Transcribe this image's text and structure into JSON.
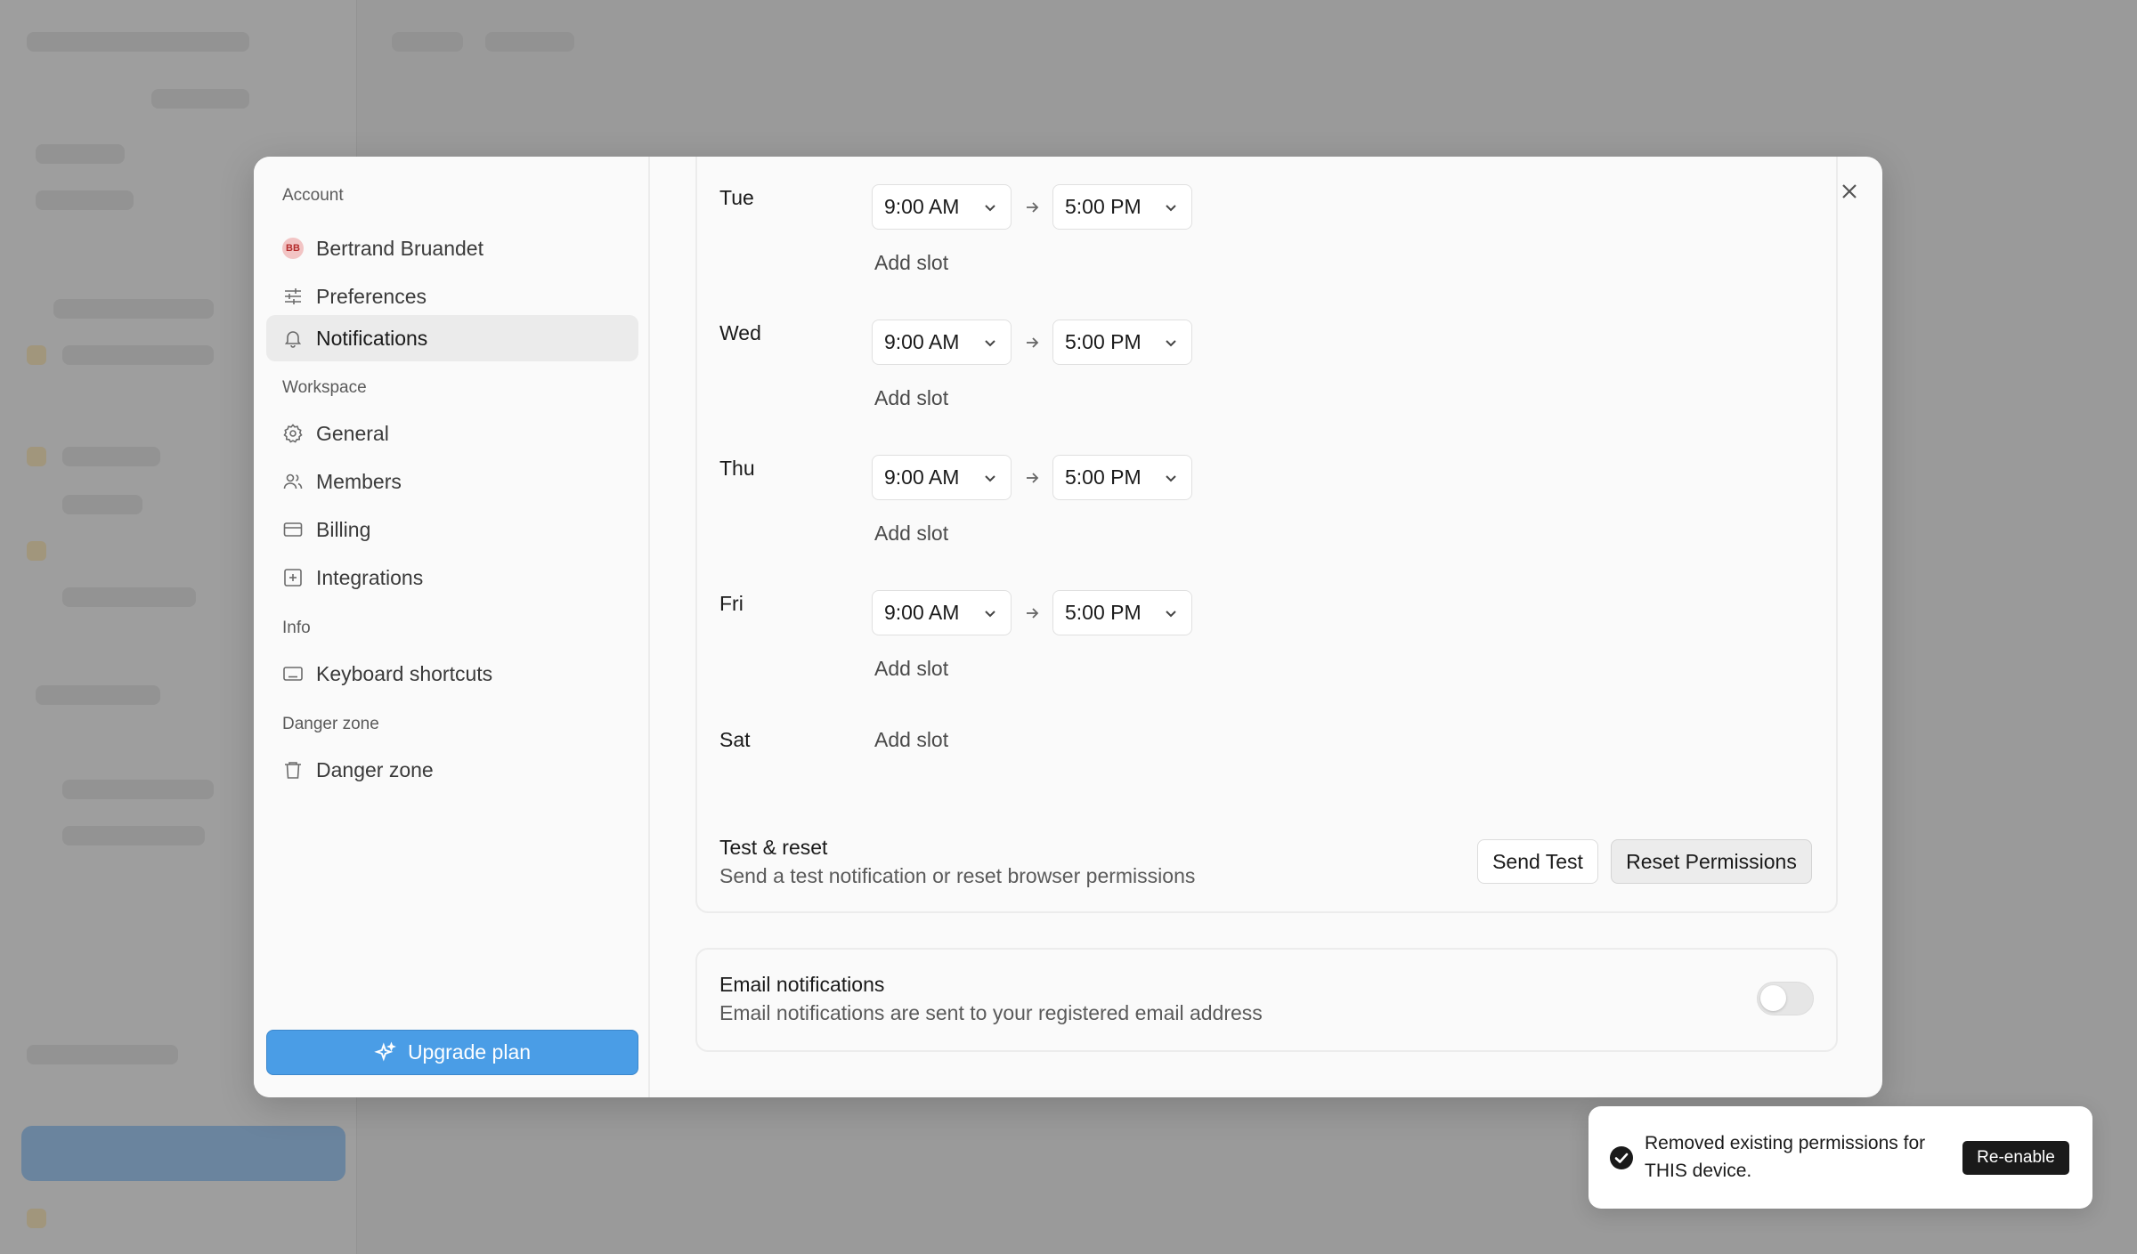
{
  "nav": {
    "account_section": "Account",
    "user": {
      "initials": "BB",
      "name": "Bertrand Bruandet"
    },
    "preferences": "Preferences",
    "notifications": "Notifications",
    "workspace_section": "Workspace",
    "general": "General",
    "members": "Members",
    "billing": "Billing",
    "integrations": "Integrations",
    "info_section": "Info",
    "keyboard_shortcuts": "Keyboard shortcuts",
    "danger_section": "Danger zone",
    "danger_zone": "Danger zone",
    "upgrade": "Upgrade plan"
  },
  "schedule": {
    "days": [
      {
        "day": "Tue",
        "start": "9:00 AM",
        "end": "5:00 PM",
        "add_slot": "Add slot"
      },
      {
        "day": "Wed",
        "start": "9:00 AM",
        "end": "5:00 PM",
        "add_slot": "Add slot"
      },
      {
        "day": "Thu",
        "start": "9:00 AM",
        "end": "5:00 PM",
        "add_slot": "Add slot"
      },
      {
        "day": "Fri",
        "start": "9:00 AM",
        "end": "5:00 PM",
        "add_slot": "Add slot"
      },
      {
        "day": "Sat",
        "add_slot": "Add slot"
      }
    ]
  },
  "test_reset": {
    "title": "Test & reset",
    "subtitle": "Send a test notification or reset browser permissions",
    "send_test": "Send Test",
    "reset_permissions": "Reset Permissions"
  },
  "email": {
    "title": "Email notifications",
    "subtitle": "Email notifications are sent to your registered email address",
    "enabled": false
  },
  "toast": {
    "message": "Removed existing permissions for THIS device.",
    "action": "Re-enable"
  },
  "colors": {
    "accent": "#4a9de6",
    "toast_button": "#1a1a1a",
    "active_nav": "#ebebeb"
  }
}
